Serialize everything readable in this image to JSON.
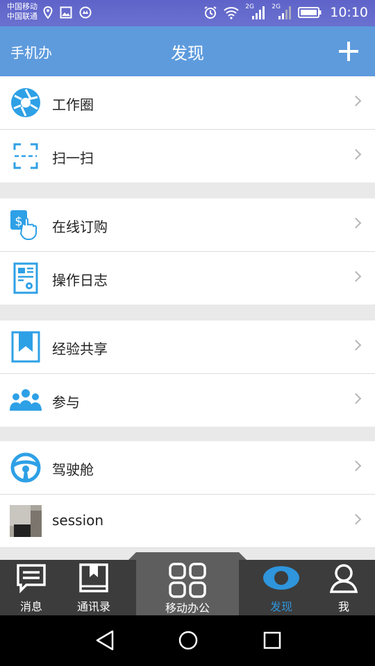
{
  "status_bar": {
    "carrier_1": "中国移动",
    "carrier_2": "中国联通",
    "net_1": "2G",
    "net_2": "2G",
    "time": "10:10"
  },
  "header": {
    "left_label": "手机办",
    "title": "发现",
    "add_icon": "plus-icon"
  },
  "sections": [
    {
      "items": [
        {
          "label": "工作圈",
          "icon": "camera-aperture-icon",
          "color": "#2ea0e6"
        },
        {
          "label": "扫一扫",
          "icon": "scan-frame-icon",
          "color": "#2ea0e6"
        }
      ]
    },
    {
      "items": [
        {
          "label": "在线订购",
          "icon": "online-purchase-icon",
          "color": "#2ea0e6"
        },
        {
          "label": "操作日志",
          "icon": "operation-log-icon",
          "color": "#2ea0e6"
        }
      ]
    },
    {
      "items": [
        {
          "label": "经验共享",
          "icon": "bookmark-icon",
          "color": "#2ea0e6"
        },
        {
          "label": "参与",
          "icon": "people-group-icon",
          "color": "#2ea0e6"
        }
      ]
    },
    {
      "items": [
        {
          "label": "驾驶舱",
          "icon": "steering-wheel-icon",
          "color": "#2ea0e6"
        },
        {
          "label": "session",
          "icon": "session-thumbnail",
          "color": "#555555"
        }
      ]
    }
  ],
  "tabs": [
    {
      "label": "消息",
      "icon": "message-icon",
      "active": false
    },
    {
      "label": "通讯录",
      "icon": "contacts-book-icon",
      "active": false
    },
    {
      "label": "移动办公",
      "icon": "app-grid-icon",
      "active": false
    },
    {
      "label": "发现",
      "icon": "eye-icon",
      "active": true
    },
    {
      "label": "我",
      "icon": "person-icon",
      "active": false
    }
  ],
  "colors": {
    "accent": "#5e9bdd",
    "active_tab": "#2f95dc",
    "icon_blue": "#2ea0e6",
    "status_bar": "#6368cc"
  }
}
